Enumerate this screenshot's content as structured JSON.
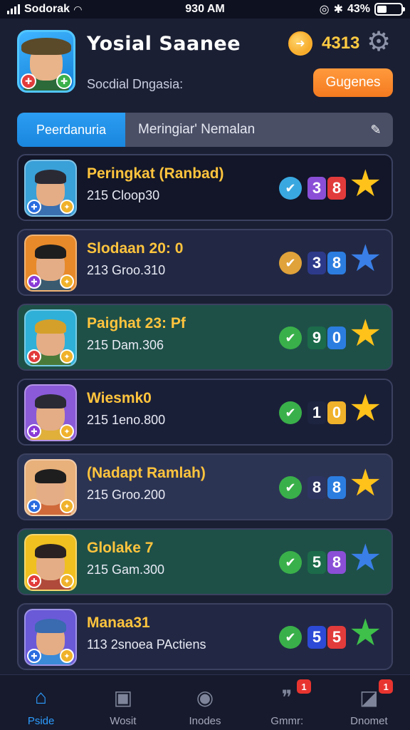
{
  "status_bar": {
    "carrier": "Sodorak",
    "time": "930 AM",
    "battery": "43%"
  },
  "header": {
    "title": "Yosial Saanee",
    "subtitle": "Socdial Dngasia:",
    "coins": "4313",
    "action_button": "Gugenes"
  },
  "tabs": {
    "active": "Peerdanuria",
    "inactive": "Meringiar' Nemalan"
  },
  "items": [
    {
      "name": "Peringkat (Ranbad)",
      "sub": "215 Cloop30",
      "score": [
        "3",
        "8"
      ],
      "score_colors": [
        "#8a4fd6",
        "#e23b3b"
      ],
      "check_color": "#3aa8e0",
      "star_color": "#ffc21a",
      "bg": "#121628",
      "avatar_bg": "#3aa0d8",
      "hat_color": "#2a2a35",
      "body_color": "#3a6fb0",
      "badge1_color": "#2a6ce0"
    },
    {
      "name": "Slodaan 20: 0",
      "sub": "213 Groo.310",
      "score": [
        "3",
        "8"
      ],
      "score_colors": [
        "#2d3a8a",
        "#2c7de0"
      ],
      "check_color": "#e0a23a",
      "star_color": "#3a7fe8",
      "bg": "#222844",
      "avatar_bg": "#e88a2a",
      "hat_color": "#1e1e1e",
      "body_color": "#3a5a70",
      "badge1_color": "#8a3ad6"
    },
    {
      "name": "Paighat 23: Pf",
      "sub": "215 Dam.306",
      "score": [
        "9",
        "0"
      ],
      "score_colors": [
        "#1c6b4a",
        "#2c7de0"
      ],
      "check_color": "#3ab04a",
      "star_color": "#ffc21a",
      "bg": "#1e5048",
      "avatar_bg": "#2fb0d8",
      "hat_color": "#d4a02a",
      "body_color": "#4a7a3a",
      "badge1_color": "#e23b3b"
    },
    {
      "name": "Wiesmk0",
      "sub": "215 1eno.800",
      "score": [
        "1",
        "0"
      ],
      "score_colors": [
        "#1c2440",
        "#f0b22a"
      ],
      "check_color": "#3ab04a",
      "star_color": "#ffc21a",
      "bg": "#1a1f38",
      "avatar_bg": "#8a5ad8",
      "hat_color": "#2a2a35",
      "body_color": "#e0b03a",
      "badge1_color": "#8a3ad6"
    },
    {
      "name": "(Nadapt Ramlah)",
      "sub": "215 Groo.200",
      "score": [
        "8",
        "8"
      ],
      "score_colors": [
        "#2d3460",
        "#2c7de0"
      ],
      "check_color": "#3ab04a",
      "star_color": "#ffc21a",
      "bg": "#2c3454",
      "avatar_bg": "#e8b07a",
      "hat_color": "#1e1e1e",
      "body_color": "#d06a3a",
      "badge1_color": "#2a6ce0"
    },
    {
      "name": "Glolake 7",
      "sub": "215 Gam.300",
      "score": [
        "5",
        "8"
      ],
      "score_colors": [
        "#1c6b4a",
        "#8a4fd6"
      ],
      "check_color": "#3ab04a",
      "star_color": "#3a7fe8",
      "bg": "#1e5048",
      "avatar_bg": "#f0c020",
      "hat_color": "#2a2222",
      "body_color": "#b04a3a",
      "badge1_color": "#e23b3b"
    },
    {
      "name": "Manaa31",
      "sub": "113 2snoea PActiens",
      "score": [
        "5",
        "5"
      ],
      "score_colors": [
        "#2c4ad6",
        "#e23b3b"
      ],
      "check_color": "#3ab04a",
      "star_color": "#3ec04a",
      "bg": "#222844",
      "avatar_bg": "#6a5ad8",
      "hat_color": "#3a6ab0",
      "body_color": "#3a8ad8",
      "badge1_color": "#2a6ce0"
    }
  ],
  "nav": [
    {
      "label": "Pside",
      "icon": "home-icon",
      "badge": ""
    },
    {
      "label": "Wosit",
      "icon": "inbox-icon",
      "badge": ""
    },
    {
      "label": "Inodes",
      "icon": "compass-icon",
      "badge": ""
    },
    {
      "label": "Gmmr:",
      "icon": "chat-icon",
      "badge": "1"
    },
    {
      "label": "Dnomet",
      "icon": "profile-icon",
      "badge": "1"
    }
  ],
  "colors": {
    "accent": "#2e9cff",
    "gold": "#ffc43d",
    "button": "#f47a20"
  }
}
